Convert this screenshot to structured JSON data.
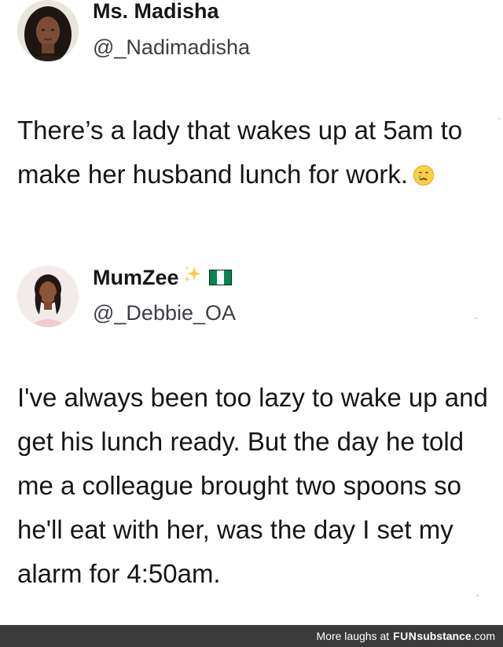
{
  "tweet_1": {
    "display_name": "Ms. Madisha",
    "handle": "@_Nadimadisha",
    "text": "There’s a lady that wakes up at 5am to make her husband lunch for work.",
    "emoji": "crying-face-icon"
  },
  "tweet_2": {
    "display_name": "MumZee",
    "handle": "@_Debbie_OA",
    "name_icons": [
      "sparkles-icon",
      "nigeria-flag-icon"
    ],
    "text": "I've always been too lazy to wake up and get his lunch ready. But the day he told me a colleague brought two spoons so he'll eat with her, was the day I set my alarm for 4:50am."
  },
  "footer": {
    "lead": "More laughs at",
    "brand_part1": "FUN",
    "brand_part2": "substance",
    "brand_tld": ".com"
  },
  "colors": {
    "text": "#14171a",
    "handle": "#3b3f44",
    "footer_bg": "#3b3b3b",
    "flag_green": "#008751",
    "flag_white": "#ffffff",
    "sparkle": "#f7c948"
  }
}
